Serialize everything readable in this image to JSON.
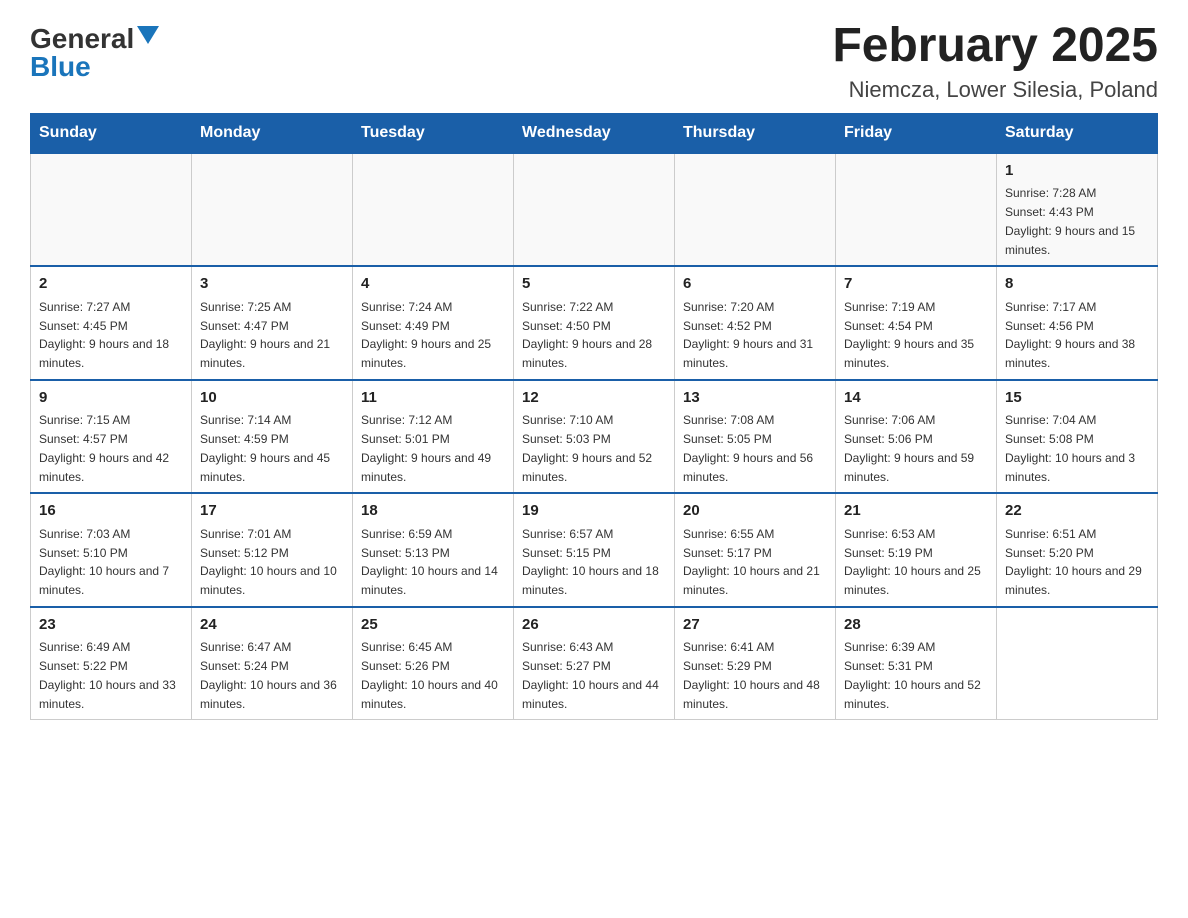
{
  "header": {
    "logo": {
      "general": "General",
      "blue": "Blue",
      "triangle_alt": "▲"
    },
    "title": "February 2025",
    "location": "Niemcza, Lower Silesia, Poland"
  },
  "weekdays": [
    "Sunday",
    "Monday",
    "Tuesday",
    "Wednesday",
    "Thursday",
    "Friday",
    "Saturday"
  ],
  "weeks": [
    [
      {
        "day": "",
        "info": ""
      },
      {
        "day": "",
        "info": ""
      },
      {
        "day": "",
        "info": ""
      },
      {
        "day": "",
        "info": ""
      },
      {
        "day": "",
        "info": ""
      },
      {
        "day": "",
        "info": ""
      },
      {
        "day": "1",
        "info": "Sunrise: 7:28 AM\nSunset: 4:43 PM\nDaylight: 9 hours and 15 minutes."
      }
    ],
    [
      {
        "day": "2",
        "info": "Sunrise: 7:27 AM\nSunset: 4:45 PM\nDaylight: 9 hours and 18 minutes."
      },
      {
        "day": "3",
        "info": "Sunrise: 7:25 AM\nSunset: 4:47 PM\nDaylight: 9 hours and 21 minutes."
      },
      {
        "day": "4",
        "info": "Sunrise: 7:24 AM\nSunset: 4:49 PM\nDaylight: 9 hours and 25 minutes."
      },
      {
        "day": "5",
        "info": "Sunrise: 7:22 AM\nSunset: 4:50 PM\nDaylight: 9 hours and 28 minutes."
      },
      {
        "day": "6",
        "info": "Sunrise: 7:20 AM\nSunset: 4:52 PM\nDaylight: 9 hours and 31 minutes."
      },
      {
        "day": "7",
        "info": "Sunrise: 7:19 AM\nSunset: 4:54 PM\nDaylight: 9 hours and 35 minutes."
      },
      {
        "day": "8",
        "info": "Sunrise: 7:17 AM\nSunset: 4:56 PM\nDaylight: 9 hours and 38 minutes."
      }
    ],
    [
      {
        "day": "9",
        "info": "Sunrise: 7:15 AM\nSunset: 4:57 PM\nDaylight: 9 hours and 42 minutes."
      },
      {
        "day": "10",
        "info": "Sunrise: 7:14 AM\nSunset: 4:59 PM\nDaylight: 9 hours and 45 minutes."
      },
      {
        "day": "11",
        "info": "Sunrise: 7:12 AM\nSunset: 5:01 PM\nDaylight: 9 hours and 49 minutes."
      },
      {
        "day": "12",
        "info": "Sunrise: 7:10 AM\nSunset: 5:03 PM\nDaylight: 9 hours and 52 minutes."
      },
      {
        "day": "13",
        "info": "Sunrise: 7:08 AM\nSunset: 5:05 PM\nDaylight: 9 hours and 56 minutes."
      },
      {
        "day": "14",
        "info": "Sunrise: 7:06 AM\nSunset: 5:06 PM\nDaylight: 9 hours and 59 minutes."
      },
      {
        "day": "15",
        "info": "Sunrise: 7:04 AM\nSunset: 5:08 PM\nDaylight: 10 hours and 3 minutes."
      }
    ],
    [
      {
        "day": "16",
        "info": "Sunrise: 7:03 AM\nSunset: 5:10 PM\nDaylight: 10 hours and 7 minutes."
      },
      {
        "day": "17",
        "info": "Sunrise: 7:01 AM\nSunset: 5:12 PM\nDaylight: 10 hours and 10 minutes."
      },
      {
        "day": "18",
        "info": "Sunrise: 6:59 AM\nSunset: 5:13 PM\nDaylight: 10 hours and 14 minutes."
      },
      {
        "day": "19",
        "info": "Sunrise: 6:57 AM\nSunset: 5:15 PM\nDaylight: 10 hours and 18 minutes."
      },
      {
        "day": "20",
        "info": "Sunrise: 6:55 AM\nSunset: 5:17 PM\nDaylight: 10 hours and 21 minutes."
      },
      {
        "day": "21",
        "info": "Sunrise: 6:53 AM\nSunset: 5:19 PM\nDaylight: 10 hours and 25 minutes."
      },
      {
        "day": "22",
        "info": "Sunrise: 6:51 AM\nSunset: 5:20 PM\nDaylight: 10 hours and 29 minutes."
      }
    ],
    [
      {
        "day": "23",
        "info": "Sunrise: 6:49 AM\nSunset: 5:22 PM\nDaylight: 10 hours and 33 minutes."
      },
      {
        "day": "24",
        "info": "Sunrise: 6:47 AM\nSunset: 5:24 PM\nDaylight: 10 hours and 36 minutes."
      },
      {
        "day": "25",
        "info": "Sunrise: 6:45 AM\nSunset: 5:26 PM\nDaylight: 10 hours and 40 minutes."
      },
      {
        "day": "26",
        "info": "Sunrise: 6:43 AM\nSunset: 5:27 PM\nDaylight: 10 hours and 44 minutes."
      },
      {
        "day": "27",
        "info": "Sunrise: 6:41 AM\nSunset: 5:29 PM\nDaylight: 10 hours and 48 minutes."
      },
      {
        "day": "28",
        "info": "Sunrise: 6:39 AM\nSunset: 5:31 PM\nDaylight: 10 hours and 52 minutes."
      },
      {
        "day": "",
        "info": ""
      }
    ]
  ]
}
